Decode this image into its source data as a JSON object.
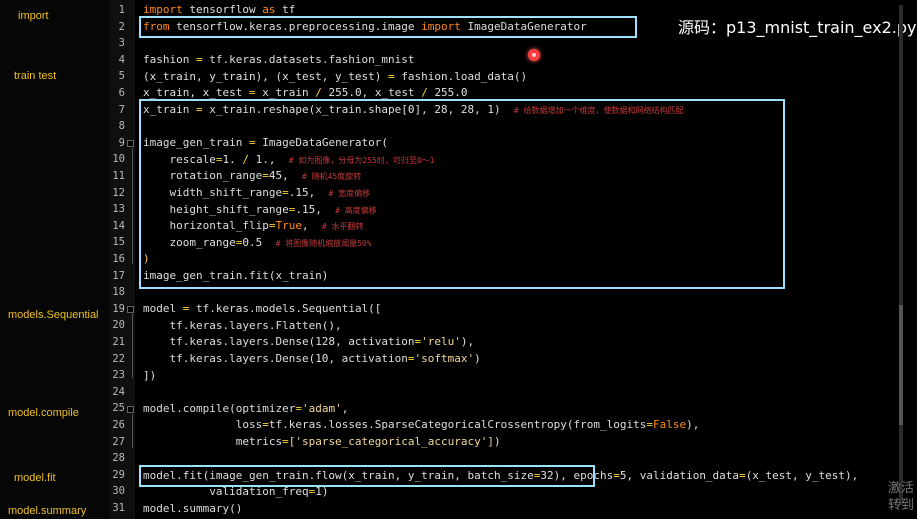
{
  "source_title": "源码：p13_mnist_train_ex2.py",
  "sections": {
    "import": "import",
    "train_test": "train  test",
    "sequential": "models.Sequential",
    "compile": "model.compile",
    "fit": "model.fit",
    "summary": "model.summary"
  },
  "line_numbers": [
    "1",
    "2",
    "3",
    "4",
    "5",
    "6",
    "7",
    "8",
    "9",
    "10",
    "11",
    "12",
    "13",
    "14",
    "15",
    "16",
    "17",
    "18",
    "19",
    "20",
    "21",
    "22",
    "23",
    "24",
    "25",
    "26",
    "27",
    "28",
    "29",
    "30",
    "31"
  ],
  "code": {
    "l1": [
      "import",
      " tensorflow ",
      "as",
      " tf"
    ],
    "l2": [
      "from",
      " tensorflow.keras.preprocessing.image ",
      "import",
      " ImageDataGenerator"
    ],
    "l4": [
      "fashion ",
      "=",
      " tf.keras.datasets.fashion_mnist"
    ],
    "l5": [
      "(x_train, y_train), (x_test, y_test) ",
      "=",
      " fashion.load_data()"
    ],
    "l6": [
      "x_train, x_test ",
      "=",
      " x_train ",
      "/",
      " ",
      "255.0",
      ", x_test ",
      "/",
      " ",
      "255.0"
    ],
    "l7": [
      "x_train ",
      "=",
      " x_train.reshape(x_train.shape[",
      "0",
      "], ",
      "28",
      ", ",
      "28",
      ", ",
      "1",
      ")  ",
      "# 给数据增加一个维度，使数据和网络结构匹配"
    ],
    "l9": [
      "image_gen_train ",
      "=",
      " ImageDataGenerator("
    ],
    "l10": [
      "    rescale",
      "=",
      "1. ",
      "/",
      " 1.,  ",
      "# 如为图像，分母为255时，可归至0～1"
    ],
    "l11": [
      "    rotation_range",
      "=",
      "45",
      ",  ",
      "# 随机45度旋转"
    ],
    "l12": [
      "    width_shift_range",
      "=",
      ".15",
      ",  ",
      "# 宽度偏移"
    ],
    "l13": [
      "    height_shift_range",
      "=",
      ".15",
      ",  ",
      "# 高度偏移"
    ],
    "l14": [
      "    horizontal_flip",
      "=",
      "True",
      ",  ",
      "# 水平翻转"
    ],
    "l15": [
      "    zoom_range",
      "=",
      "0.5",
      "  ",
      "# 将图像随机缩放阈量50%"
    ],
    "l16": [
      ")"
    ],
    "l17": [
      "image_gen_train.fit(x_train)"
    ],
    "l19": [
      "model ",
      "=",
      " tf.keras.models.Sequential(["
    ],
    "l20": [
      "    tf.keras.layers.Flatten(),"
    ],
    "l21": [
      "    tf.keras.layers.Dense(",
      "128",
      ", activation",
      "=",
      "'relu'",
      "),"
    ],
    "l22": [
      "    tf.keras.layers.Dense(",
      "10",
      ", activation",
      "=",
      "'softmax'",
      ")"
    ],
    "l23": [
      "])"
    ],
    "l25": [
      "model.compile(optimizer",
      "=",
      "'adam'",
      ","
    ],
    "l26": [
      "              loss",
      "=",
      "tf.keras.losses.SparseCategoricalCrossentropy(from_logits",
      "=",
      "False",
      "),"
    ],
    "l27": [
      "              metrics",
      "=",
      "['sparse_categorical_accuracy']",
      ")"
    ],
    "l29": [
      "model.fit(image_gen_train.flow(x_train, y_train, batch_size",
      "=",
      "32",
      "), epochs",
      "=",
      "5",
      ", validation_data",
      "=",
      "(x_test, y_test),"
    ],
    "l30": [
      "          validation_freq",
      "=",
      "1",
      ")"
    ],
    "l31": [
      "model.summary()"
    ]
  },
  "watermark": "激活 转到"
}
